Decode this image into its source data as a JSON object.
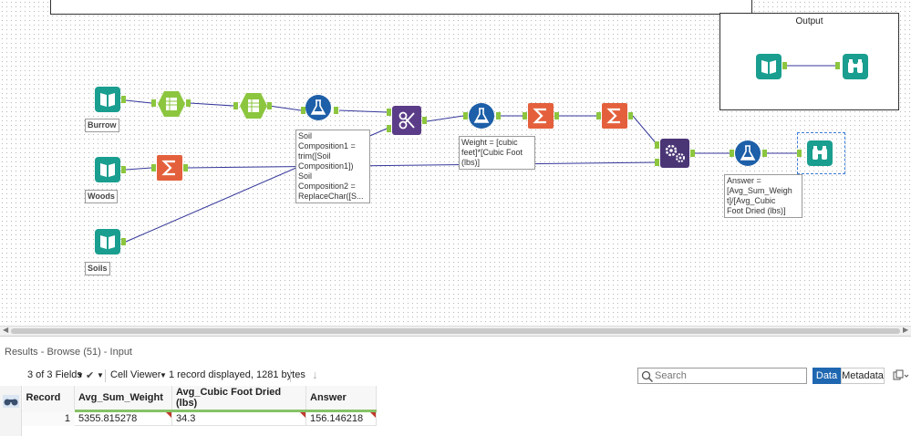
{
  "canvas": {
    "container_title": "Output",
    "labels": {
      "burrow": "Burrow",
      "woods": "Woods",
      "soils": "Soils",
      "formula1": "Soil\nComposition1 =\ntrim([Soil\nComposition1])\nSoil\nComposition2 =\nReplaceChar([S...",
      "formula2": "Weight = [cubic\nfeet]*[Cubic Foot\n(lbs)]",
      "formula3": "Answer =\n[Avg_Sum_Weigh\nt]/[Avg_Cubic\nFoot Dried (lbs)]"
    }
  },
  "results": {
    "title": "Results - Browse (51) - Input",
    "fields_label": "3 of 3 Fields",
    "viewer_label": "Cell Viewer",
    "records_info": "1 record displayed, 1281 bytes",
    "search_placeholder": "Search",
    "data_button": "Data",
    "metadata_button": "Metadata"
  },
  "grid": {
    "headers": [
      "Record",
      "Avg_Sum_Weight",
      "Avg_Cubic Foot Dried (lbs)",
      "Answer"
    ],
    "rows": [
      [
        "1",
        "5355.815278",
        "34.3",
        "156.146218"
      ]
    ]
  },
  "colors": {
    "input_tool": "#1a9e8f",
    "select_tool": "#8cc63f",
    "formula_tool": "#1d5fa8",
    "summarize_tool": "#e4603c",
    "join_tool": "#5b3c88",
    "append_tool": "#4a3575",
    "browse_tool": "#1a9e8f",
    "connection": "#34379a"
  }
}
